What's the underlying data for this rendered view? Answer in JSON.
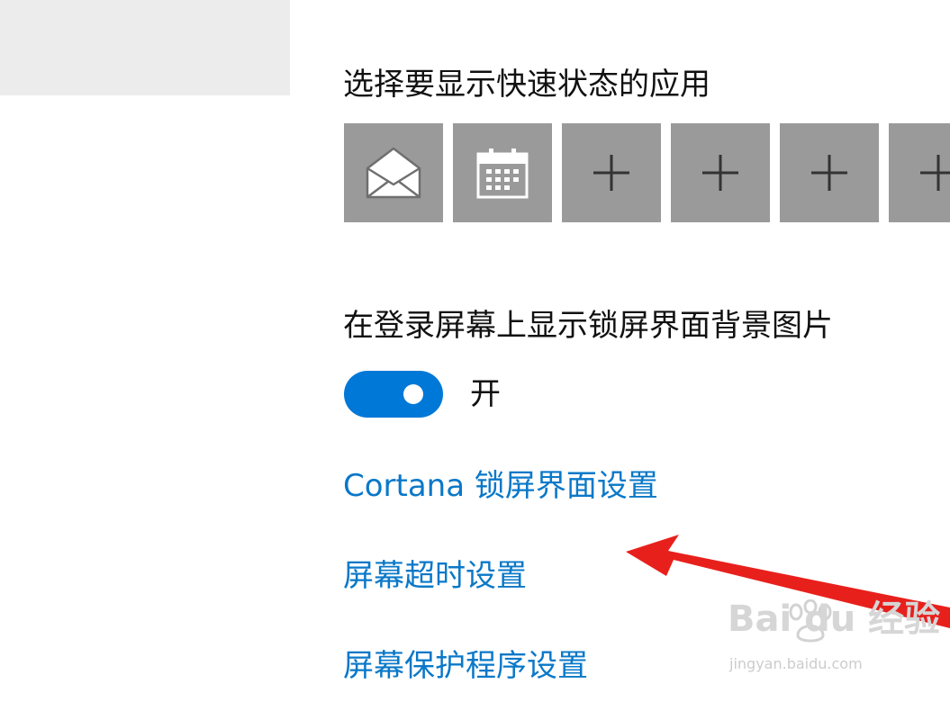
{
  "quick_status": {
    "heading": "选择要显示快速状态的应用",
    "tiles": [
      {
        "icon": "mail-icon",
        "kind": "app"
      },
      {
        "icon": "calendar-icon",
        "kind": "app"
      },
      {
        "icon": "plus-icon",
        "kind": "add"
      },
      {
        "icon": "plus-icon",
        "kind": "add"
      },
      {
        "icon": "plus-icon",
        "kind": "add"
      },
      {
        "icon": "plus-icon",
        "kind": "add"
      }
    ]
  },
  "lock_background": {
    "heading": "在登录屏幕上显示锁屏界面背景图片",
    "toggle_on": true,
    "toggle_state_label": "开"
  },
  "links": {
    "cortana": "Cortana 锁屏界面设置",
    "screen_timeout": "屏幕超时设置",
    "screen_saver": "屏幕保护程序设置"
  },
  "watermark": {
    "logo": "Bai du 经验",
    "url": "jingyan.baidu.com"
  },
  "colors": {
    "accent": "#0078d7",
    "link": "#0a78c8",
    "tile": "#9a9a9a",
    "annotation_arrow": "#e8201c"
  }
}
